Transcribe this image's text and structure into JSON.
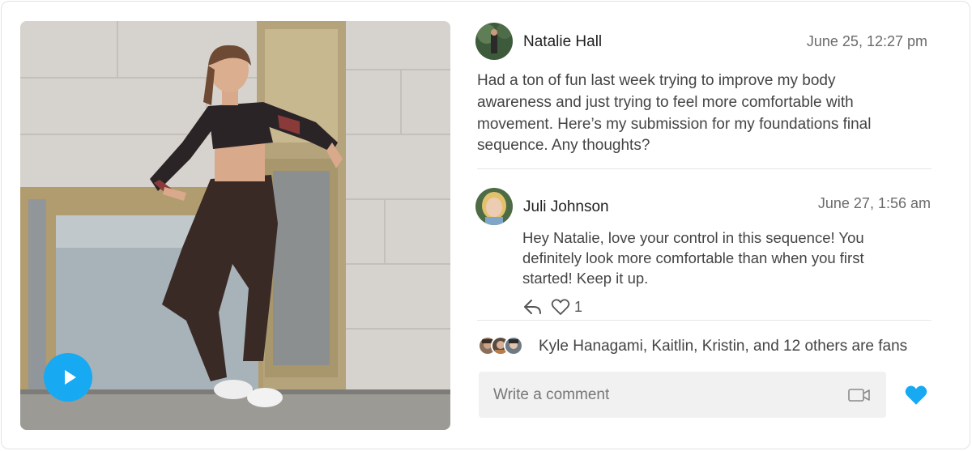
{
  "post": {
    "author": "Natalie Hall",
    "date": "June 25, 12:27 pm",
    "body_lines": [
      "Had a ton of fun last week trying to improve my body",
      "awareness and just trying to feel more comfortable with",
      "movement. Here’s my submission for my foundations final",
      "sequence. Any thoughts?"
    ]
  },
  "comment": {
    "author": "Juli Johnson",
    "date": "June 27, 1:56 am",
    "body_lines": [
      "Hey Natalie, love your control in this sequence! You",
      "definitely look more comfortable than when you first",
      "started! Keep it up."
    ],
    "like_count": "1",
    "icons": [
      "reply-icon",
      "heart-outline-icon"
    ]
  },
  "fans": {
    "text": "Kyle Hanagami, Kaitlin, Kristin, and 12 others are fans"
  },
  "composer": {
    "placeholder": "Write a comment",
    "icons": [
      "video-camera-icon",
      "heart-filled-icon"
    ]
  },
  "media": {
    "icons": [
      "play-icon"
    ]
  },
  "colors": {
    "accent": "#17a9f2",
    "divider": "#e6e6e6",
    "input_bg": "#f1f1f1"
  }
}
